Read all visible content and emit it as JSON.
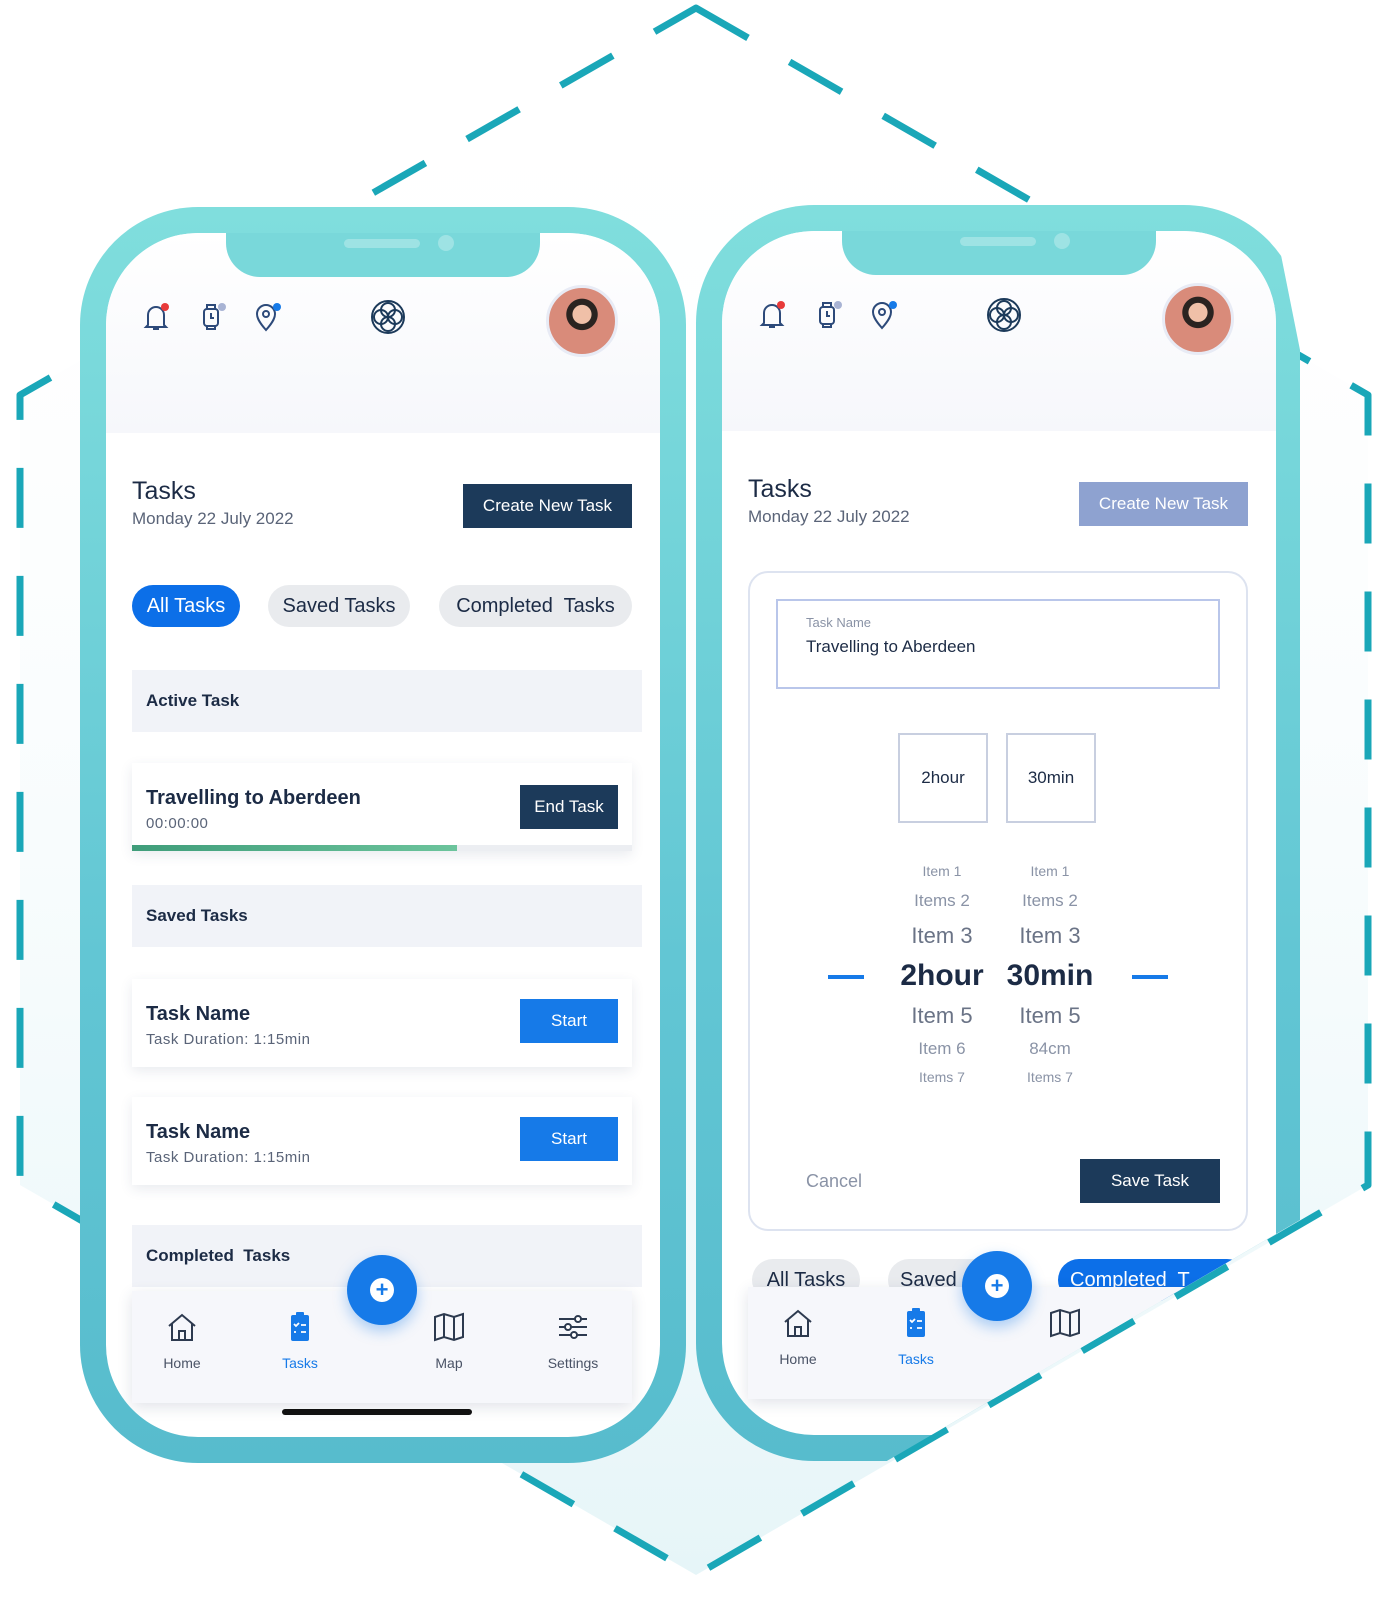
{
  "colors": {
    "accent": "#167ae8",
    "dark": "#1c3a5a",
    "frame": "#62c6d4",
    "outline": "#1aa7b8",
    "progress": "#4fae86"
  },
  "header_icons": [
    "bell-icon",
    "watch-icon",
    "location-pin-icon",
    "flower-logo-icon",
    "avatar"
  ],
  "left": {
    "title": "Tasks",
    "date": "Monday 22 July 2022",
    "create_btn": "Create New Task",
    "tabs": [
      {
        "label": "All Tasks",
        "active": true
      },
      {
        "label": "Saved Tasks",
        "active": false
      },
      {
        "label": "Completed  Tasks",
        "active": false
      }
    ],
    "active_section": "Active Task",
    "active_task": {
      "name": "Travelling to Aberdeen",
      "timer": "00:00:00",
      "button": "End Task",
      "progress": 0.65
    },
    "saved_section": "Saved Tasks",
    "saved": [
      {
        "name": "Task Name",
        "duration": "Task Duration: 1:15min",
        "button": "Start"
      },
      {
        "name": "Task Name",
        "duration": "Task Duration: 1:15min",
        "button": "Start"
      }
    ],
    "completed_section": "Completed  Tasks",
    "nav": [
      {
        "label": "Home",
        "icon": "home-icon"
      },
      {
        "label": "Tasks",
        "icon": "clipboard-icon",
        "active": true
      },
      {
        "label": "Map",
        "icon": "map-icon"
      },
      {
        "label": "Settings",
        "icon": "sliders-icon"
      }
    ]
  },
  "right": {
    "title": "Tasks",
    "date": "Monday 22 July 2022",
    "create_btn": "Create New Task",
    "form": {
      "field_label": "Task Name",
      "field_value": "Travelling to Aberdeen",
      "hour_box": "2hour",
      "min_box": "30min",
      "hours": [
        "Item 1",
        "Items 2",
        "Item 3",
        "2hour",
        "Item 5",
        "Item 6",
        "Items 7"
      ],
      "mins": [
        "Item 1",
        "Items 2",
        "Item 3",
        "30min",
        "Item 5",
        "84cm",
        "Items 7"
      ],
      "cancel": "Cancel",
      "save": "Save Task"
    },
    "tabs": [
      {
        "label": "All Tasks"
      },
      {
        "label": "Saved"
      },
      {
        "label": "Completed  T"
      }
    ],
    "nav": [
      {
        "label": "Home"
      },
      {
        "label": "Tasks"
      }
    ]
  }
}
